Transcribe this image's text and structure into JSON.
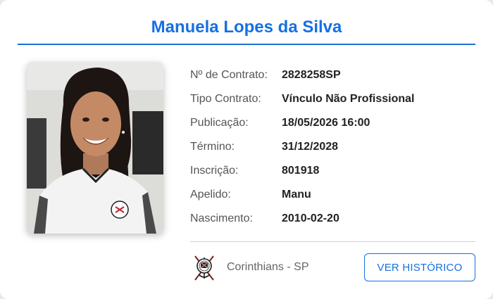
{
  "player": {
    "name": "Manuela Lopes da Silva"
  },
  "photo": {
    "alt": "player-photo"
  },
  "details": [
    {
      "label": "Nº de Contrato:",
      "value": "2828258SP"
    },
    {
      "label": "Tipo Contrato:",
      "value": "Vínculo Não Profissional"
    },
    {
      "label": "Publicação:",
      "value": "18/05/2026 16:00"
    },
    {
      "label": "Término:",
      "value": "31/12/2028"
    },
    {
      "label": "Inscrição:",
      "value": "801918"
    },
    {
      "label": "Apelido:",
      "value": "Manu"
    },
    {
      "label": "Nascimento:",
      "value": "2010-02-20"
    }
  ],
  "club": {
    "name": "Corinthians - SP",
    "logo_icon": "corinthians-crest-icon"
  },
  "actions": {
    "history_label": "VER HISTÓRICO"
  },
  "colors": {
    "accent": "#1570e3",
    "rule": "#1f6fd6",
    "label": "#555555",
    "value": "#222222"
  }
}
